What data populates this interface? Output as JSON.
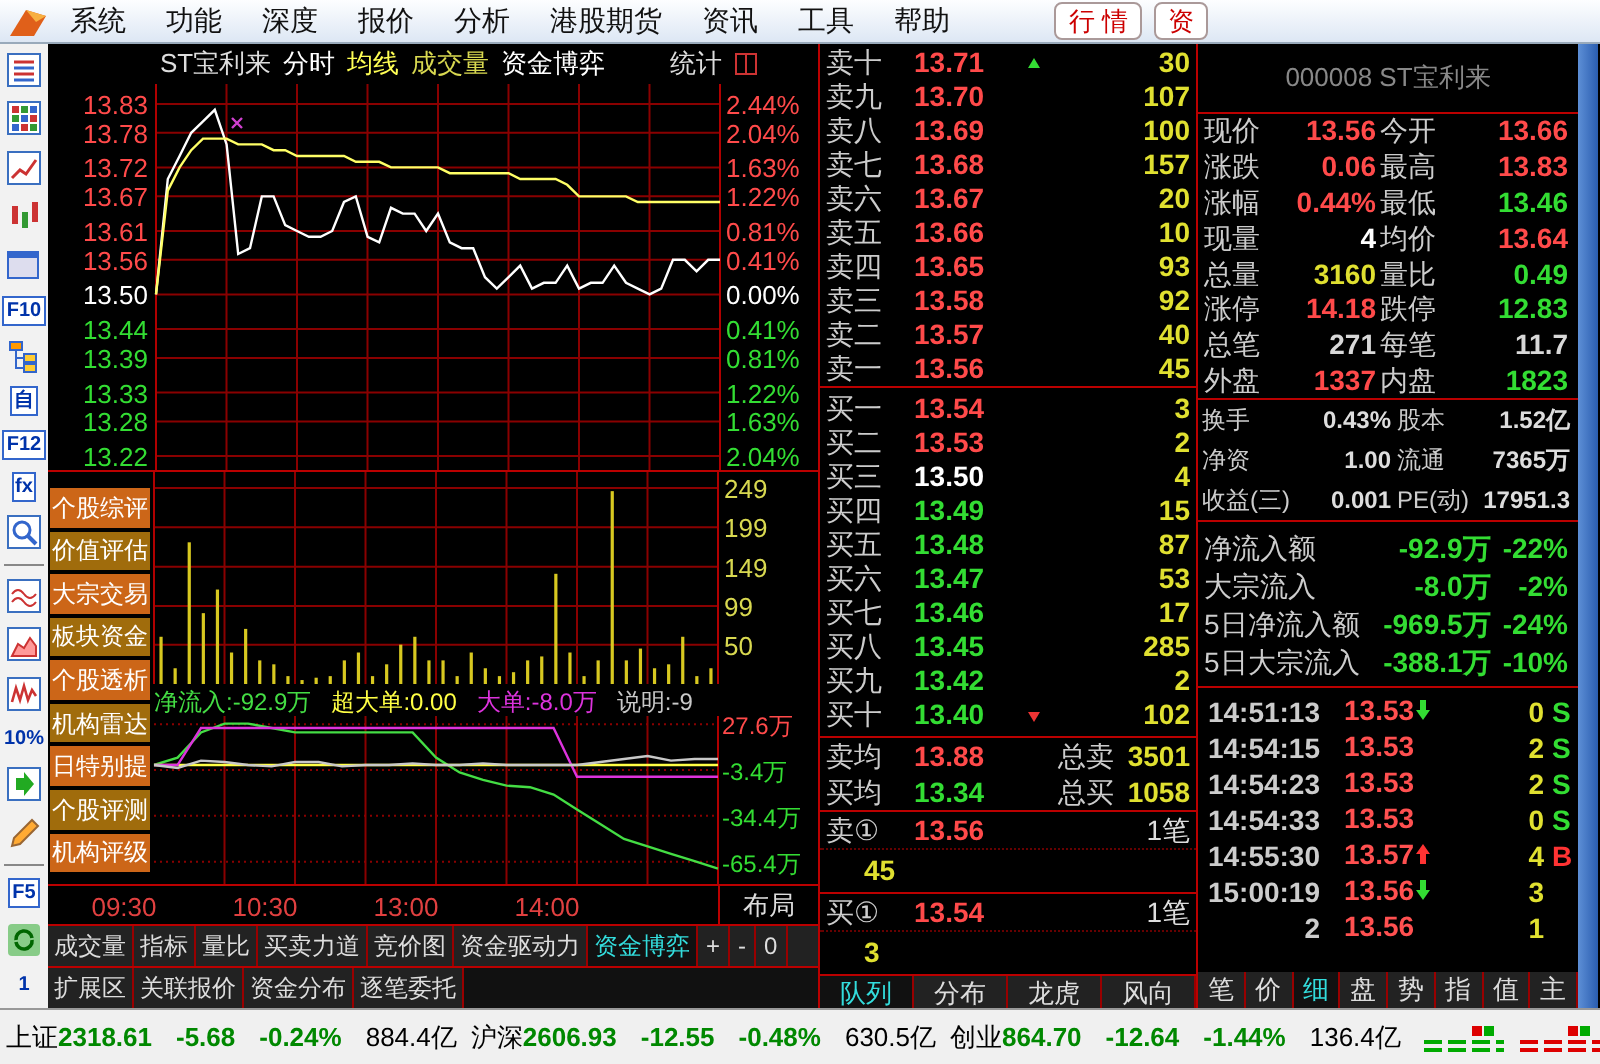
{
  "menu": {
    "items": [
      "系统",
      "功能",
      "深度",
      "报价",
      "分析",
      "港股期货",
      "资讯",
      "工具",
      "帮助"
    ],
    "buttons": [
      "行 情",
      "资"
    ]
  },
  "side_toolbar": {
    "labels": [
      {
        "text": "F10",
        "kind": "key"
      },
      {
        "text": "自",
        "kind": "key"
      },
      {
        "text": "F12",
        "kind": "key"
      },
      {
        "text": "fx",
        "kind": "key"
      },
      {
        "text": "10%",
        "kind": "plain"
      },
      {
        "text": "F5",
        "kind": "key"
      },
      {
        "text": "1",
        "kind": "plain"
      }
    ]
  },
  "chart": {
    "title": "ST宝利来",
    "views": [
      {
        "label": "分时",
        "color": "#ffffff"
      },
      {
        "label": "均线",
        "color": "#ffff55"
      },
      {
        "label": "成交量",
        "color": "#d8d850"
      },
      {
        "label": "资金博弈",
        "color": "#ffffff"
      }
    ],
    "stat": "统计",
    "price_pct": [
      {
        "label": "2.44%",
        "color": "#ff4a4a"
      },
      {
        "label": "2.04%",
        "color": "#ff4a4a"
      },
      {
        "label": "1.63%",
        "color": "#ff4a4a"
      },
      {
        "label": "1.22%",
        "color": "#ff4a4a"
      },
      {
        "label": "0.81%",
        "color": "#ff4a4a"
      },
      {
        "label": "0.41%",
        "color": "#ff4a4a"
      },
      {
        "label": "0.00%",
        "color": "#ffffff"
      },
      {
        "label": "0.41%",
        "color": "#33dd33"
      },
      {
        "label": "0.81%",
        "color": "#33dd33"
      },
      {
        "label": "1.22%",
        "color": "#33dd33"
      },
      {
        "label": "1.63%",
        "color": "#33dd33"
      },
      {
        "label": "2.04%",
        "color": "#33dd33"
      }
    ],
    "chart_data": {
      "type": "line",
      "grid": true,
      "ylim": [
        13.22,
        13.83
      ],
      "categories": [
        null,
        null,
        null,
        null,
        null,
        null,
        null,
        null,
        null,
        null,
        null,
        null,
        null,
        null,
        null,
        null,
        null,
        null,
        null,
        null,
        null,
        null,
        null,
        null,
        null,
        null,
        null,
        null,
        null,
        null,
        null,
        null,
        null,
        null,
        null,
        null,
        null,
        null,
        null,
        null,
        null,
        null,
        null,
        null,
        null,
        null,
        null,
        null,
        null
      ],
      "yticks": [
        {
          "value": 13.83,
          "label": "13.83"
        },
        {
          "value": 13.78,
          "label": "13.78"
        },
        {
          "value": 13.72,
          "label": "13.72"
        },
        {
          "value": 13.67,
          "label": "13.67"
        },
        {
          "value": 13.61,
          "label": "13.61"
        },
        {
          "value": 13.56,
          "label": "13.56"
        },
        {
          "value": 13.5,
          "label": "13.50"
        },
        {
          "value": 13.44,
          "label": "13.44"
        },
        {
          "value": 13.39,
          "label": "13.39"
        },
        {
          "value": 13.33,
          "label": "13.33"
        },
        {
          "value": 13.28,
          "label": "13.28"
        },
        {
          "value": 13.22,
          "label": "13.22"
        }
      ],
      "series": [
        {
          "color": "#ffffff",
          "values": [
            13.5,
            13.7,
            13.74,
            13.78,
            13.8,
            13.82,
            13.76,
            13.57,
            13.58,
            13.67,
            13.67,
            13.62,
            13.61,
            13.6,
            13.6,
            13.61,
            13.66,
            13.67,
            13.6,
            13.59,
            13.65,
            13.64,
            13.64,
            13.61,
            13.64,
            13.59,
            13.58,
            13.58,
            13.53,
            13.51,
            13.53,
            13.55,
            13.51,
            13.52,
            13.52,
            13.55,
            13.51,
            13.52,
            13.52,
            13.55,
            13.52,
            13.51,
            13.5,
            13.51,
            13.56,
            13.56,
            13.54,
            13.56,
            13.56
          ]
        },
        {
          "color": "#ffff66",
          "values": [
            13.5,
            13.68,
            13.72,
            13.75,
            13.77,
            13.77,
            13.77,
            13.76,
            13.76,
            13.76,
            13.75,
            13.75,
            13.74,
            13.74,
            13.74,
            13.74,
            13.74,
            13.73,
            13.73,
            13.73,
            13.72,
            13.72,
            13.72,
            13.72,
            13.72,
            13.71,
            13.71,
            13.71,
            13.71,
            13.71,
            13.71,
            13.7,
            13.7,
            13.7,
            13.7,
            13.69,
            13.67,
            13.67,
            13.67,
            13.67,
            13.67,
            13.66,
            13.66,
            13.66,
            13.66,
            13.66,
            13.66,
            13.66,
            13.66
          ]
        }
      ]
    },
    "volume": {
      "chart_data": {
        "type": "bar",
        "grid": true,
        "ylim": [
          0,
          249
        ],
        "categories": [
          null,
          null,
          null,
          null,
          null,
          null,
          null,
          null,
          null,
          null,
          null,
          null,
          null,
          null,
          null,
          null,
          null,
          null,
          null,
          null,
          null,
          null,
          null,
          null,
          null,
          null,
          null,
          null,
          null,
          null,
          null,
          null,
          null,
          null,
          null,
          null,
          null,
          null,
          null,
          null
        ],
        "yticks": [
          {
            "value": 249,
            "label": "249"
          },
          {
            "value": 199,
            "label": "199"
          },
          {
            "value": 149,
            "label": "149"
          },
          {
            "value": 99,
            "label": "99"
          },
          {
            "value": 50,
            "label": "50"
          }
        ],
        "series": [
          {
            "color": "#d8c820",
            "values": [
              60,
              20,
              180,
              90,
              120,
              40,
              70,
              30,
              25,
              10,
              5,
              8,
              10,
              30,
              40,
              10,
              25,
              50,
              60,
              30,
              30,
              10,
              40,
              20,
              10,
              15,
              30,
              35,
              140,
              40,
              10,
              30,
              245,
              30,
              45,
              20,
              25,
              60,
              10,
              20
            ]
          }
        ]
      }
    },
    "side_buttons": [
      {
        "label": "个股综评",
        "color": "#cc6618"
      },
      {
        "label": "价值评估",
        "color": "#a06c0c"
      },
      {
        "label": "大宗交易",
        "color": "#cc6618"
      },
      {
        "label": "板块资金",
        "color": "#a06c0c"
      },
      {
        "label": "个股透析",
        "color": "#cc6618"
      },
      {
        "label": "机构雷达",
        "color": "#a06c0c"
      },
      {
        "label": "日特别提",
        "color": "#cc6618"
      },
      {
        "label": "个股评测",
        "color": "#a06c0c"
      },
      {
        "label": "机构评级",
        "color": "#cc6618"
      }
    ],
    "flow": {
      "chart_data": {
        "type": "line",
        "grid": true,
        "ylim": [
          -81.8,
          33.1
        ],
        "categories": [
          null,
          null,
          null,
          null,
          null,
          null,
          null,
          null,
          null,
          null,
          null,
          null,
          null,
          null,
          null,
          null,
          null,
          null,
          null,
          null,
          null,
          null,
          null,
          null,
          null
        ],
        "yticks": [
          {
            "value": 27.6,
            "label": "27.6万"
          },
          {
            "value": -3.4,
            "label": "-3.4万"
          },
          {
            "value": -34.4,
            "label": "-34.4万"
          },
          {
            "value": -65.4,
            "label": "-65.4万"
          }
        ],
        "series": [
          {
            "name": "净流入:-92.9万",
            "color": "#44dd44",
            "values": [
              0,
              5,
              22,
              28,
              28,
              25,
              22,
              22,
              22,
              22,
              22,
              22,
              5,
              -5,
              -10,
              -14,
              -15,
              -20,
              -30,
              -40,
              -50,
              -55,
              -60,
              -65,
              -70
            ]
          },
          {
            "name": "超大单:0.00",
            "color": "#ffff44",
            "values": [
              0,
              0,
              0,
              0,
              0,
              0,
              0,
              0,
              0,
              0,
              0,
              0,
              0,
              0,
              0,
              0,
              0,
              0,
              0,
              0,
              0,
              0,
              0,
              0,
              0
            ]
          },
          {
            "name": "大单:-8.0万",
            "color": "#dd33dd",
            "values": [
              0,
              0,
              25,
              25,
              25,
              25,
              25,
              25,
              25,
              25,
              25,
              25,
              25,
              25,
              25,
              25,
              25,
              25,
              -8,
              -8,
              -8,
              -8,
              -8,
              -8,
              -8
            ]
          },
          {
            "name": "说明:-9",
            "color": "#c8c8c8",
            "values": [
              0,
              -2,
              3,
              2,
              0,
              -1,
              2,
              2,
              -1,
              0,
              0,
              1,
              0,
              0,
              1,
              0,
              0,
              0,
              0,
              2,
              4,
              6,
              3,
              4,
              4
            ]
          }
        ]
      }
    },
    "time_labels": [
      "09:30",
      "10:30",
      "13:00",
      "14:00"
    ],
    "layout_label": "布局"
  },
  "bottom_tabs": {
    "row1": [
      {
        "label": "成交量",
        "selected": false
      },
      {
        "label": "指标",
        "selected": false
      },
      {
        "label": "量比",
        "selected": false
      },
      {
        "label": "买卖力道",
        "selected": false
      },
      {
        "label": "竞价图",
        "selected": false
      },
      {
        "label": "资金驱动力",
        "selected": false
      },
      {
        "label": "资金博弈",
        "selected": true
      }
    ],
    "controls": [
      "+",
      "-",
      "0"
    ],
    "row2": [
      {
        "label": "扩展区",
        "selected": false
      },
      {
        "label": "关联报价",
        "selected": false
      },
      {
        "label": "资金分布",
        "selected": false
      },
      {
        "label": "逐笔委托",
        "selected": false
      }
    ]
  },
  "order_book": {
    "asks": [
      {
        "label": "卖十",
        "price": "13.71",
        "volume": "30",
        "color": "#ff4a4a",
        "marked": true
      },
      {
        "label": "卖九",
        "price": "13.70",
        "volume": "107",
        "color": "#ff4a4a",
        "marked": false
      },
      {
        "label": "卖八",
        "price": "13.69",
        "volume": "100",
        "color": "#ff4a4a",
        "marked": false
      },
      {
        "label": "卖七",
        "price": "13.68",
        "volume": "157",
        "color": "#ff4a4a",
        "marked": false
      },
      {
        "label": "卖六",
        "price": "13.67",
        "volume": "20",
        "color": "#ff4a4a",
        "marked": false
      },
      {
        "label": "卖五",
        "price": "13.66",
        "volume": "10",
        "color": "#ff4a4a",
        "marked": false
      },
      {
        "label": "卖四",
        "price": "13.65",
        "volume": "93",
        "color": "#ff4a4a",
        "marked": false
      },
      {
        "label": "卖三",
        "price": "13.58",
        "volume": "92",
        "color": "#ff4a4a",
        "marked": false
      },
      {
        "label": "卖二",
        "price": "13.57",
        "volume": "40",
        "color": "#ff4a4a",
        "marked": false
      },
      {
        "label": "卖一",
        "price": "13.56",
        "volume": "45",
        "color": "#ff4a4a",
        "marked": false
      }
    ],
    "bids": [
      {
        "label": "买一",
        "price": "13.54",
        "volume": "3",
        "color": "#ff4a4a",
        "marked": false
      },
      {
        "label": "买二",
        "price": "13.53",
        "volume": "2",
        "color": "#ff4a4a",
        "marked": false
      },
      {
        "label": "买三",
        "price": "13.50",
        "volume": "4",
        "color": "#ffffff",
        "marked": false
      },
      {
        "label": "买四",
        "price": "13.49",
        "volume": "15",
        "color": "#33dd33",
        "marked": false
      },
      {
        "label": "买五",
        "price": "13.48",
        "volume": "87",
        "color": "#33dd33",
        "marked": false
      },
      {
        "label": "买六",
        "price": "13.47",
        "volume": "53",
        "color": "#33dd33",
        "marked": false
      },
      {
        "label": "买七",
        "price": "13.46",
        "volume": "17",
        "color": "#33dd33",
        "marked": false
      },
      {
        "label": "买八",
        "price": "13.45",
        "volume": "285",
        "color": "#33dd33",
        "marked": false
      },
      {
        "label": "买九",
        "price": "13.42",
        "volume": "2",
        "color": "#33dd33",
        "marked": false
      },
      {
        "label": "买十",
        "price": "13.40",
        "volume": "102",
        "color": "#33dd33",
        "marked": true
      }
    ],
    "averages": [
      {
        "label": "卖均",
        "price": "13.88",
        "color": "#ff4a4a",
        "total_label": "总卖",
        "total": "3501"
      },
      {
        "label": "买均",
        "price": "13.34",
        "color": "#33dd33",
        "total_label": "总买",
        "total": "1058"
      }
    ],
    "queues": [
      {
        "label": "卖①",
        "price": "13.56",
        "color": "#ff4a4a",
        "orders": "1笔",
        "volume": "45"
      },
      {
        "label": "买①",
        "price": "13.54",
        "color": "#ff4a4a",
        "orders": "1笔",
        "volume": "3"
      }
    ],
    "tabs": [
      {
        "label": "队列",
        "selected": true
      },
      {
        "label": "分布",
        "selected": false
      },
      {
        "label": "龙虎",
        "selected": false
      },
      {
        "label": "风向",
        "selected": false
      }
    ]
  },
  "quote": {
    "header": "000008 ST宝利来",
    "stats": [
      {
        "label": "现价",
        "value": "13.56",
        "color": "#ff4a4a"
      },
      {
        "label": "今开",
        "value": "13.66",
        "color": "#ff4a4a"
      },
      {
        "label": "涨跌",
        "value": "0.06",
        "color": "#ff4a4a"
      },
      {
        "label": "最高",
        "value": "13.83",
        "color": "#ff4a4a"
      },
      {
        "label": "涨幅",
        "value": "0.44%",
        "color": "#ff4a4a"
      },
      {
        "label": "最低",
        "value": "13.46",
        "color": "#33dd33"
      },
      {
        "label": "现量",
        "value": "4",
        "color": "#ffffff"
      },
      {
        "label": "均价",
        "value": "13.64",
        "color": "#ff4a4a"
      },
      {
        "label": "总量",
        "value": "3160",
        "color": "#e0e030"
      },
      {
        "label": "量比",
        "value": "0.49",
        "color": "#33dd33"
      },
      {
        "label": "涨停",
        "value": "14.18",
        "color": "#ff4a4a"
      },
      {
        "label": "跌停",
        "value": "12.83",
        "color": "#33dd33"
      },
      {
        "label": "总笔",
        "value": "271",
        "color": "#d8d8d8"
      },
      {
        "label": "每笔",
        "value": "11.7",
        "color": "#d8d8d8"
      },
      {
        "label": "外盘",
        "value": "1337",
        "color": "#ff4a4a"
      },
      {
        "label": "内盘",
        "value": "1823",
        "color": "#33dd33"
      }
    ],
    "fundamentals": [
      {
        "label": "换手",
        "value": "0.43%"
      },
      {
        "label": "股本",
        "value": "1.52亿"
      },
      {
        "label": "净资",
        "value": "1.00"
      },
      {
        "label": "流通",
        "value": "7365万"
      },
      {
        "label": "收益(三)",
        "value": "0.001"
      },
      {
        "label": "PE(动)",
        "value": "17951.3"
      }
    ],
    "flows": [
      {
        "label": "净流入额",
        "amount": "-92.9万",
        "pct": "-22%",
        "color": "#33dd33"
      },
      {
        "label": "大宗流入",
        "amount": "-8.0万",
        "pct": "-2%",
        "color": "#33dd33"
      },
      {
        "label": "5日净流入额",
        "amount": "-969.5万",
        "pct": "-24%",
        "color": "#33dd33"
      },
      {
        "label": "5日大宗流入",
        "amount": "-388.1万",
        "pct": "-10%",
        "color": "#33dd33"
      }
    ],
    "ticks": [
      {
        "time": "14:51:13",
        "price": "13.53",
        "kind": "downtick",
        "volume": "0",
        "side": "S"
      },
      {
        "time": "14:54:15",
        "price": "13.53",
        "kind": "plain",
        "volume": "2",
        "side": "S"
      },
      {
        "time": "14:54:23",
        "price": "13.53",
        "kind": "plain",
        "volume": "2",
        "side": "S"
      },
      {
        "time": "14:54:33",
        "price": "13.53",
        "kind": "plain",
        "volume": "0",
        "side": "S"
      },
      {
        "time": "14:55:30",
        "price": "13.57",
        "kind": "uptick",
        "volume": "4",
        "side": "B"
      },
      {
        "time": "15:00:19",
        "price": "13.56",
        "kind": "downtick",
        "volume": "3"
      },
      {
        "time": "2",
        "price": "13.56",
        "kind": "plain",
        "volume": "1"
      }
    ],
    "tabs": [
      {
        "label": "笔",
        "selected": false
      },
      {
        "label": "价",
        "selected": false
      },
      {
        "label": "细",
        "selected": true
      },
      {
        "label": "盘",
        "selected": false
      },
      {
        "label": "势",
        "selected": false
      },
      {
        "label": "指",
        "selected": false
      },
      {
        "label": "值",
        "selected": false
      },
      {
        "label": "主",
        "selected": false
      }
    ]
  },
  "status_bar": {
    "indices": [
      {
        "name": "上证",
        "value": "2318.61",
        "change": "-5.68",
        "pct": "-0.24%",
        "amount": "884.4亿",
        "color": "#008800"
      },
      {
        "name": "沪深",
        "value": "2606.93",
        "change": "-12.55",
        "pct": "-0.48%",
        "amount": "630.5亿",
        "color": "#008800"
      },
      {
        "name": "创业",
        "value": "864.70",
        "change": "-12.64",
        "pct": "-1.44%",
        "amount": "136.4亿",
        "color": "#008800"
      }
    ]
  }
}
